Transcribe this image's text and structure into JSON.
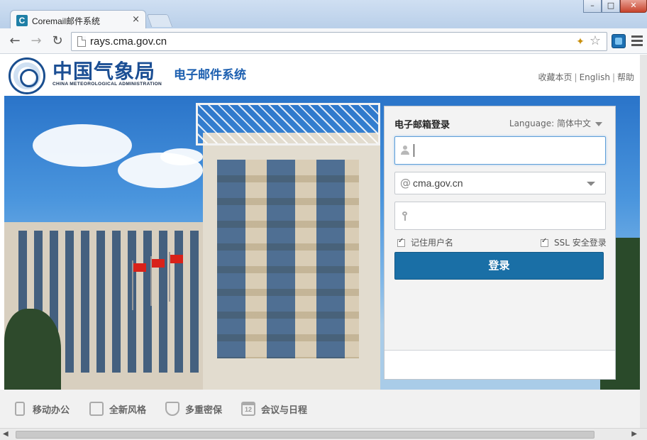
{
  "browser": {
    "tab_title": "Coremail邮件系统",
    "tab_icon_letter": "C",
    "tab_close": "×",
    "url": "rays.cma.gov.cn",
    "back": "←",
    "forward": "→",
    "reload": "↻",
    "star": "☆",
    "win_minimize": "–",
    "win_maximize": "□",
    "win_close": "✕"
  },
  "header": {
    "org_name_cn": "中国气象局",
    "org_name_en": "CHINA METEOROLOGICAL ADMINISTRATION",
    "system_name": "电子邮件系统",
    "links": [
      "收藏本页",
      "English",
      "帮助"
    ],
    "link_separator": "|"
  },
  "login": {
    "title": "电子邮箱登录",
    "language_label": "Language:",
    "language_value": "简体中文",
    "username_value": "",
    "domain_prefix": "@",
    "domain_value": "cma.gov.cn",
    "password_value": "",
    "remember_label": "记住用户名",
    "ssl_label": "SSL 安全登录",
    "remember_checked": true,
    "ssl_checked": true,
    "submit_label": "登录"
  },
  "features": [
    {
      "label": "移动办公",
      "icon": "mobile-phone-icon"
    },
    {
      "label": "全新风格",
      "icon": "style-icon"
    },
    {
      "label": "多重密保",
      "icon": "shield-icon"
    },
    {
      "label": "会议与日程",
      "icon": "calendar-icon",
      "icon_text": "12"
    }
  ],
  "scrollbar": {
    "left_arrow": "◀",
    "right_arrow": "▶"
  },
  "colors": {
    "brand_blue": "#1c4f94",
    "login_button": "#1a6fa6",
    "focus_border": "#5f9fd8"
  }
}
